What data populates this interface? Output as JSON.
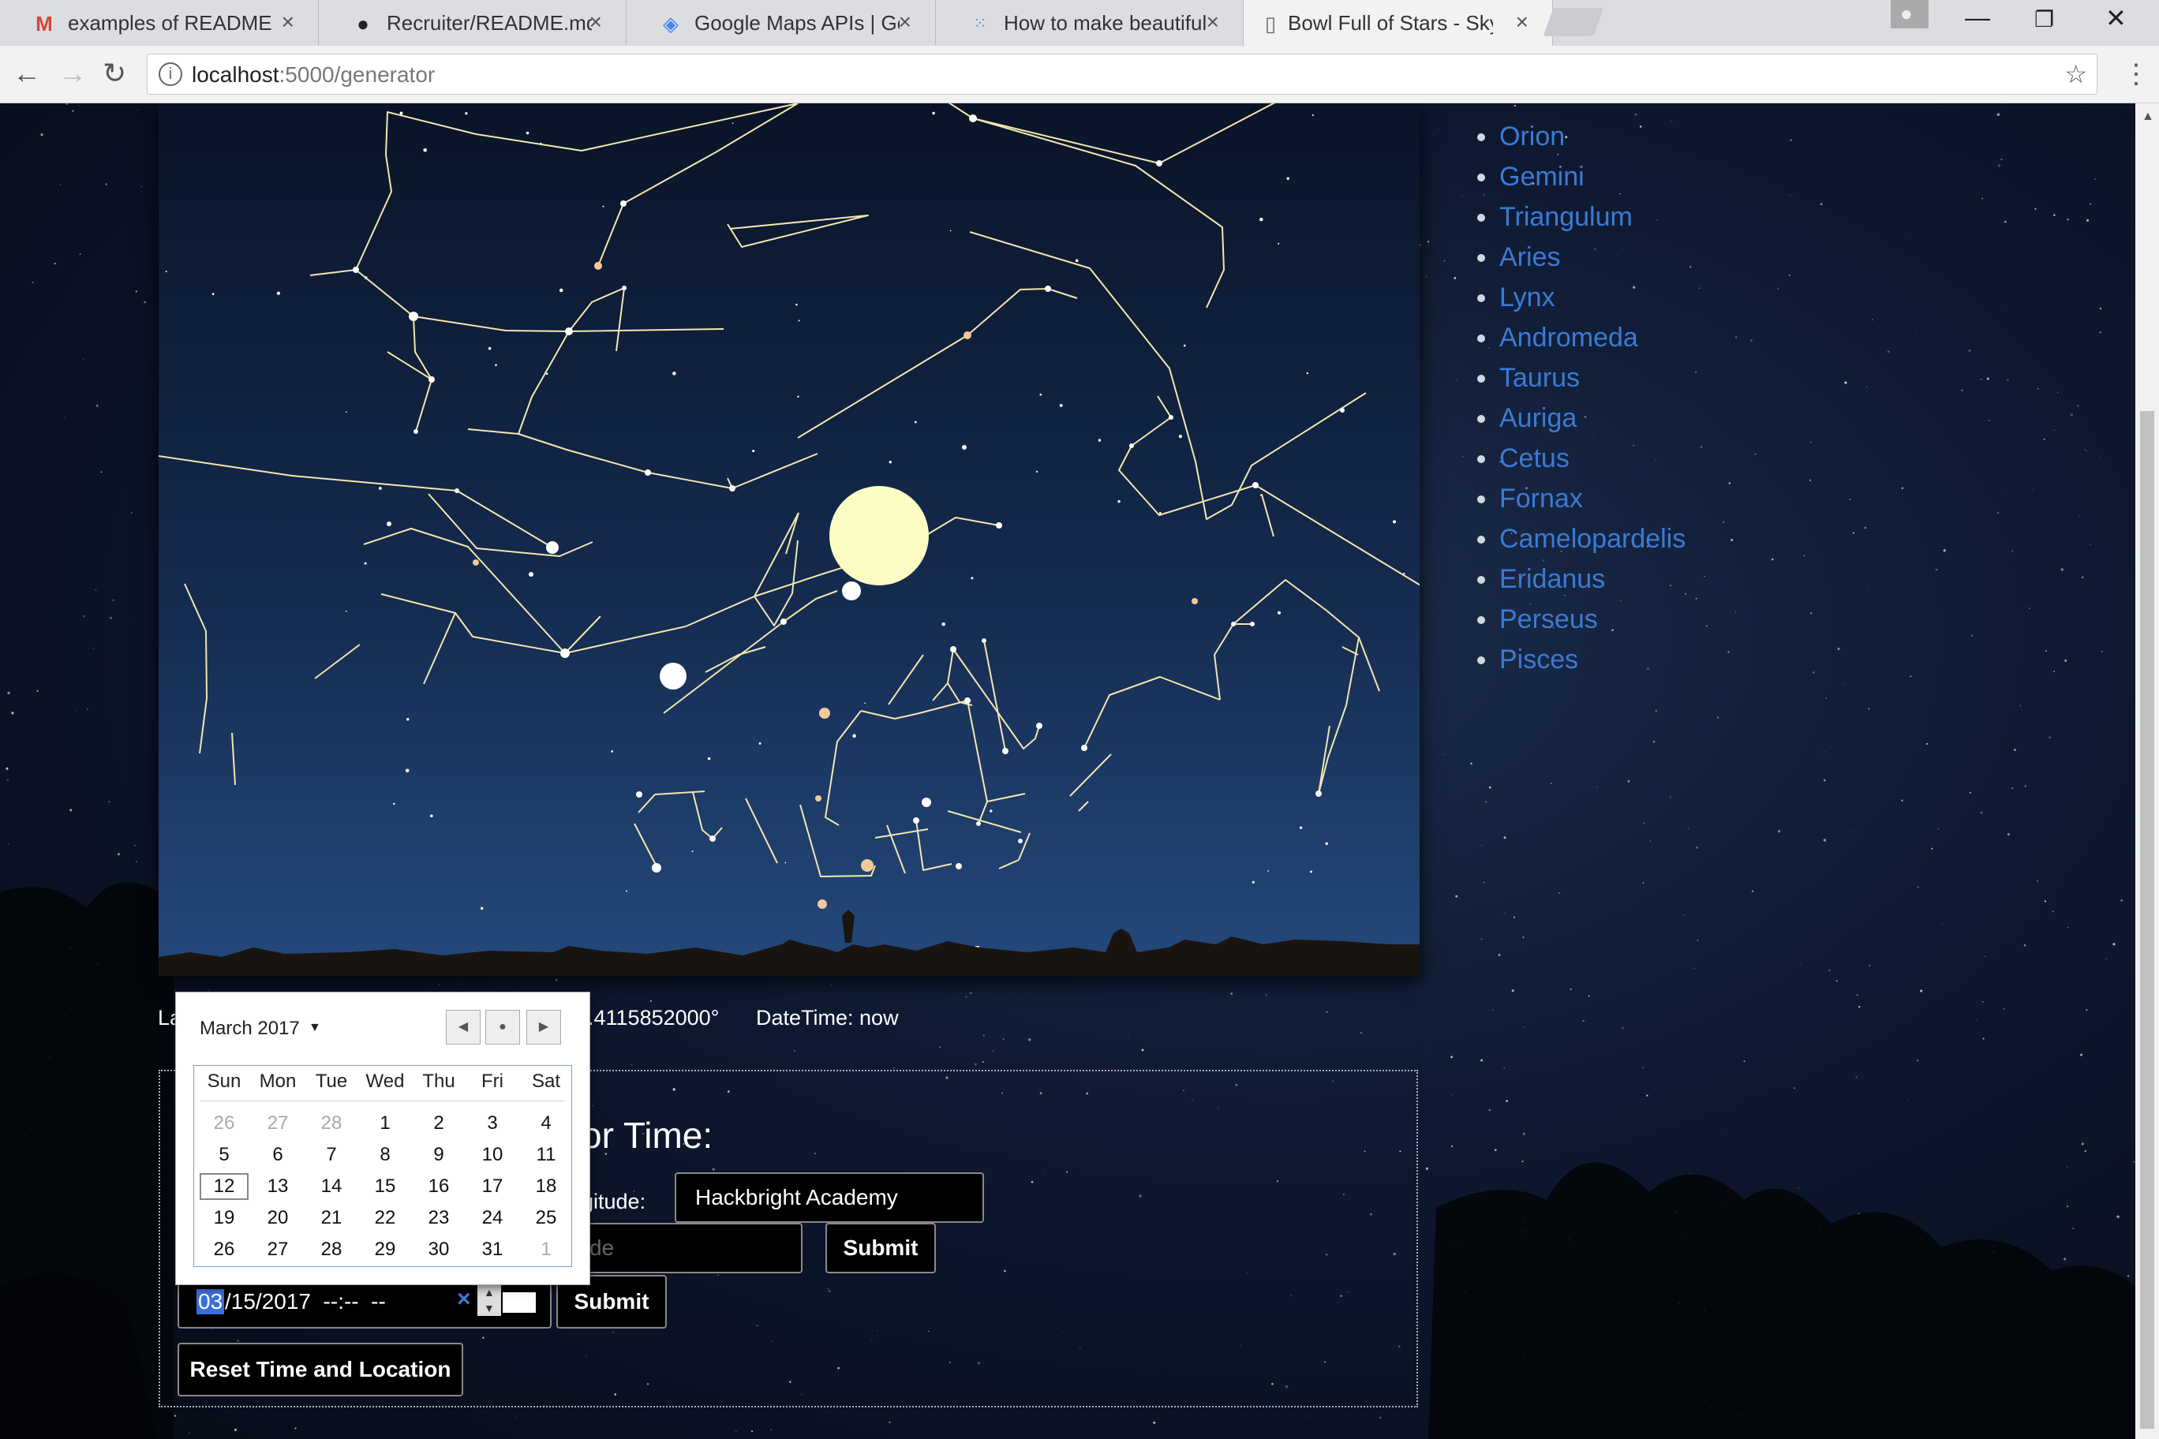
{
  "browser": {
    "tabs": [
      {
        "title": "examples of README for",
        "icon": "gmail-icon",
        "active": false
      },
      {
        "title": "Recruiter/README.md at",
        "icon": "github-icon",
        "active": false
      },
      {
        "title": "Google Maps APIs | Goo",
        "icon": "google-developers-icon",
        "active": false
      },
      {
        "title": "How to make beautiful G",
        "icon": "dots-grid-icon",
        "active": false
      },
      {
        "title": "Bowl Full of Stars - Sky",
        "icon": "document-icon",
        "active": true
      }
    ],
    "tab_close_glyph": "×",
    "url_host": "localhost",
    "url_path": ":5000/generator"
  },
  "constellations": [
    "Orion",
    "Gemini",
    "Triangulum",
    "Aries",
    "Lynx",
    "Andromeda",
    "Taurus",
    "Auriga",
    "Cetus",
    "Fornax",
    "Camelopardelis",
    "Eridanus",
    "Perseus",
    "Pisces"
  ],
  "info": {
    "latitude_fragment": "La",
    "longitude_fragment": "2.4115852000°",
    "datetime": "DateTime: now"
  },
  "form": {
    "heading_fragment": "or Time:",
    "longitude_label_fragment": "gitude:",
    "place_value": "Hackbright Academy",
    "lat_placeholder_fragment": "de",
    "submit_location": "Submit",
    "date_selected_part": "03",
    "date_rest": "/15/2017  --:--  --",
    "submit_datetime": "Submit",
    "reset": "Reset Time and Location"
  },
  "calendar": {
    "month_label": "March 2017",
    "weekdays": [
      "Sun",
      "Mon",
      "Tue",
      "Wed",
      "Thu",
      "Fri",
      "Sat"
    ],
    "weeks": [
      [
        "26",
        "27",
        "28",
        "1",
        "2",
        "3",
        "4"
      ],
      [
        "5",
        "6",
        "7",
        "8",
        "9",
        "10",
        "11"
      ],
      [
        "12",
        "13",
        "14",
        "15",
        "16",
        "17",
        "18"
      ],
      [
        "19",
        "20",
        "21",
        "22",
        "23",
        "24",
        "25"
      ],
      [
        "26",
        "27",
        "28",
        "29",
        "30",
        "31",
        "1"
      ]
    ],
    "muted_leading": 3,
    "muted_trailing": 1,
    "today": "12"
  },
  "colors": {
    "link": "#3a7bd5",
    "constellation_line": "#f2e6b0",
    "moon": "#fdfcc4",
    "star_orange": "#f5c89a",
    "date_highlight": "#3a6fd8"
  }
}
